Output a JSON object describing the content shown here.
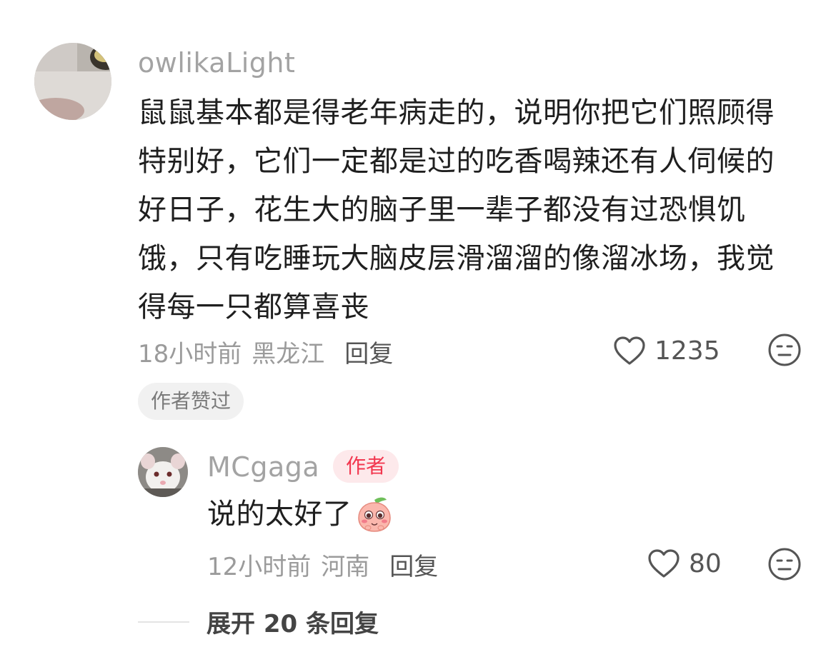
{
  "comments": [
    {
      "username": "owlikaLight",
      "lines": [
        "鼠鼠基本都是得老年病走的，说明你把它们照顾得",
        "特别好，它们一定都是过的吃香喝辣还有人伺候的",
        "好日子，花生大的脑子里一辈子都没有过恐惧饥",
        "饿，只有吃睡玩大脑皮层滑溜溜的像溜冰场，我觉",
        "得每一只都算喜丧"
      ],
      "time": "18小时前",
      "location": "黑龙江",
      "reply_label": "回复",
      "likes": "1235",
      "badge": "作者赞过"
    }
  ],
  "reply": {
    "username": "MCgaga",
    "author_badge": "作者",
    "text": "说的太好了",
    "emoji": "blushing-peach-emoji",
    "time": "12小时前",
    "location": "河南",
    "reply_label": "回复",
    "likes": "80"
  },
  "expand": {
    "label": "展开 20 条回复"
  },
  "colors": {
    "username": "#a3a3a3",
    "text": "#1f1f1f",
    "meta": "#9b9b9b",
    "author_badge_bg": "#fde9eb",
    "author_badge_text": "#f2374f"
  },
  "icons": {
    "like": "heart-outline-icon",
    "dislike": "meh-face-icon"
  }
}
